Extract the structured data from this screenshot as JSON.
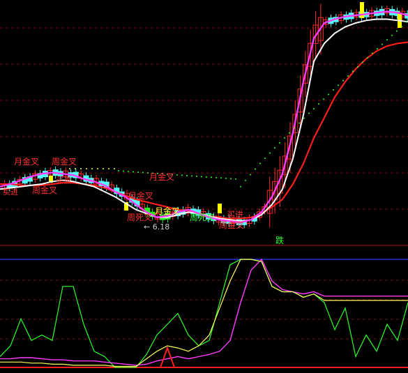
{
  "chart_data": [
    {
      "type": "candlestick",
      "panel": "price",
      "low_marker": "← 6.18",
      "signals": {
        "yue_jin_cha": "月金叉",
        "zhou_jin_cha": "周金叉",
        "mai_jin": "买进",
        "zhou_si_cha": "周死叉",
        "die": "跌"
      },
      "colors": {
        "up": "#ff2a2a",
        "down": "#54ffff",
        "flat": "#ffff3c",
        "ma_short": "#ff3cff",
        "ma_mid": "#ffffff",
        "ma_long": "#ff1e1e",
        "dotted": "#2aff2a",
        "highlight": "#ffff00",
        "green_block": "#22ee22"
      },
      "series_ma_short": [
        4.5,
        4.6,
        4.75,
        4.9,
        5.0,
        5.05,
        5.0,
        4.95,
        4.8,
        4.7,
        4.55,
        4.3,
        4.1,
        3.8,
        3.5,
        3.3,
        3.35,
        3.5,
        3.6,
        3.45,
        3.3,
        3.2,
        3.15,
        3.1,
        3.2,
        3.5,
        4.1,
        5.0,
        6.6,
        8.6,
        10.3,
        10.9,
        11.05,
        11.15,
        11.2,
        11.25,
        11.3,
        11.35,
        11.3,
        11.2
      ],
      "series_ma_mid": [
        4.4,
        4.45,
        4.5,
        4.55,
        4.6,
        4.7,
        4.75,
        4.7,
        4.6,
        4.5,
        4.3,
        4.1,
        3.85,
        3.6,
        3.45,
        3.3,
        3.3,
        3.4,
        3.5,
        3.45,
        3.35,
        3.25,
        3.2,
        3.15,
        3.2,
        3.4,
        3.8,
        4.4,
        5.6,
        7.3,
        9.4,
        10.1,
        10.5,
        10.75,
        10.9,
        11.0,
        11.05,
        11.05,
        11.0,
        10.95
      ],
      "series_ma_long": [
        4.6,
        4.6,
        4.55,
        4.55,
        4.55,
        4.6,
        4.65,
        4.65,
        4.6,
        4.55,
        4.45,
        4.3,
        4.15,
        4.0,
        3.9,
        3.8,
        3.7,
        3.6,
        3.55,
        3.45,
        3.35,
        3.3,
        3.25,
        3.25,
        3.3,
        3.45,
        3.7,
        4.0,
        4.6,
        5.4,
        6.4,
        7.2,
        8.0,
        8.6,
        9.1,
        9.5,
        9.8,
        10.0,
        10.1,
        10.15
      ],
      "y_range": [
        2.2,
        11.8
      ]
    },
    {
      "type": "line",
      "panel": "indicator",
      "y_range": [
        0,
        100
      ],
      "series_green": [
        10,
        20,
        45,
        25,
        30,
        25,
        75,
        75,
        40,
        15,
        10,
        0,
        0,
        0,
        12,
        30,
        40,
        50,
        30,
        20,
        25,
        60,
        95,
        100,
        100,
        98,
        75,
        70,
        70,
        65,
        68,
        60,
        35,
        55,
        10,
        30,
        15,
        40,
        25,
        60
      ],
      "series_yellow": [
        5,
        5,
        5,
        4,
        4,
        3,
        3,
        2,
        2,
        2,
        2,
        1,
        1,
        1,
        8,
        15,
        20,
        18,
        15,
        20,
        30,
        55,
        80,
        100,
        100,
        98,
        75,
        70,
        70,
        65,
        68,
        62,
        62,
        62,
        62,
        62,
        62,
        62,
        62,
        62
      ],
      "series_magenta": [
        8,
        8,
        9,
        9,
        8,
        7,
        7,
        6,
        6,
        6,
        5,
        4,
        3,
        2,
        3,
        6,
        8,
        10,
        8,
        10,
        12,
        15,
        25,
        60,
        90,
        100,
        80,
        72,
        70,
        68,
        70,
        66,
        66,
        66,
        66,
        66,
        66,
        66,
        66,
        66
      ],
      "spike_x": 16,
      "spike_height": 28
    }
  ]
}
